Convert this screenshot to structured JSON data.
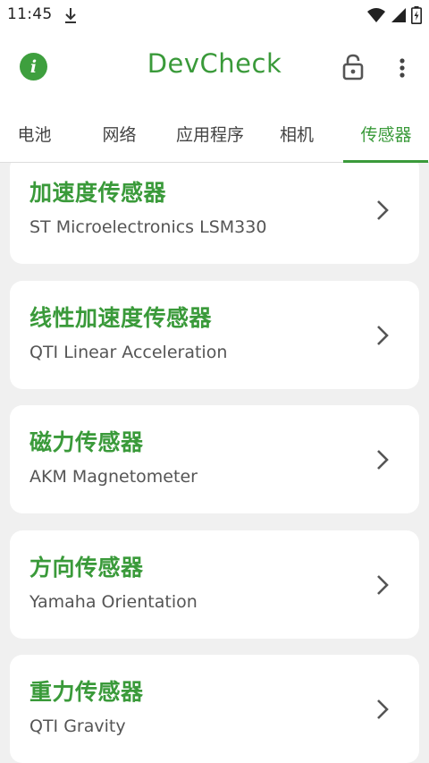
{
  "status_bar": {
    "time": "11:45",
    "icons": [
      "download-icon",
      "wifi-icon",
      "signal-icon",
      "battery-charging-icon"
    ]
  },
  "app_bar": {
    "title": "DevCheck",
    "icons": [
      "info-icon",
      "lock-open-icon",
      "more-vert-icon"
    ],
    "accent_color": "#3a9a3a"
  },
  "tabs": [
    {
      "label": "电池",
      "active": false
    },
    {
      "label": "网络",
      "active": false
    },
    {
      "label": "应用程序",
      "active": false
    },
    {
      "label": "相机",
      "active": false
    },
    {
      "label": "传感器",
      "active": true
    }
  ],
  "sensors": [
    {
      "name": "加速度传感器",
      "detail": "ST Microelectronics LSM330"
    },
    {
      "name": "线性加速度传感器",
      "detail": "QTI Linear Acceleration"
    },
    {
      "name": "磁力传感器",
      "detail": "AKM Magnetometer"
    },
    {
      "name": "方向传感器",
      "detail": "Yamaha Orientation"
    },
    {
      "name": "重力传感器",
      "detail": "QTI Gravity"
    }
  ]
}
